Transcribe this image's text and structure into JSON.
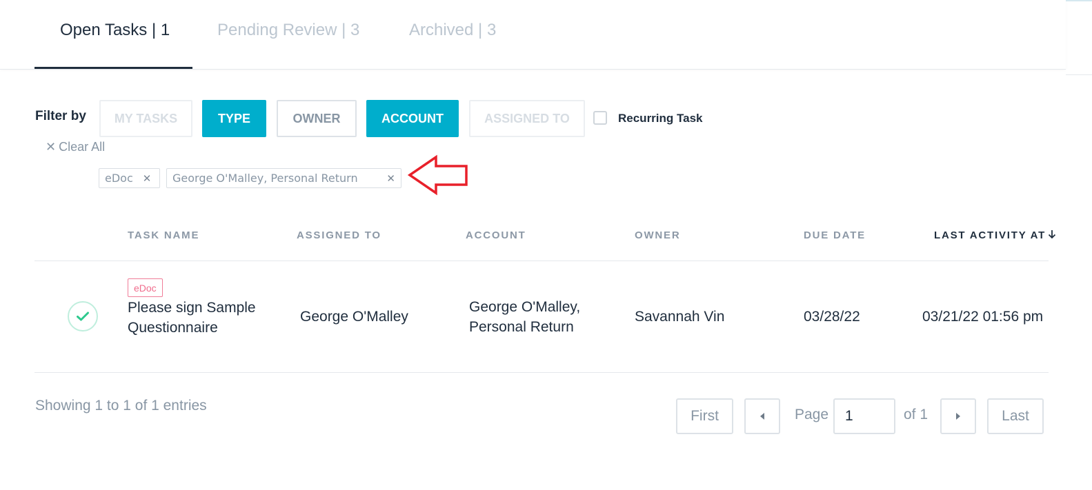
{
  "tabs": [
    {
      "label": "Open Tasks | 1",
      "active": true
    },
    {
      "label": "Pending Review | 3",
      "active": false
    },
    {
      "label": "Archived | 3",
      "active": false
    }
  ],
  "filter": {
    "label": "Filter by",
    "buttons": {
      "my_tasks": "MY TASKS",
      "type": "TYPE",
      "owner": "OWNER",
      "account": "ACCOUNT",
      "assigned_to": "ASSIGNED TO"
    },
    "recurring_label": "Recurring Task",
    "clear_all": "Clear All",
    "chips": [
      "eDoc",
      "George O'Malley, Personal Return"
    ]
  },
  "table": {
    "headers": {
      "task_name": "TASK NAME",
      "assigned_to": "ASSIGNED TO",
      "account": "ACCOUNT",
      "owner": "OWNER",
      "due_date": "DUE DATE",
      "last_activity": "LAST ACTIVITY AT"
    },
    "rows": [
      {
        "tag": "eDoc",
        "task_name": "Please sign Sample Questionnaire",
        "assigned_to": "George O'Malley",
        "account": "George O'Malley, Personal Return",
        "owner": "Savannah Vin",
        "due_date": "03/28/22",
        "last_activity": "03/21/22 01:56 pm"
      }
    ]
  },
  "pagination": {
    "showing": "Showing 1 to 1 of 1 entries",
    "first": "First",
    "page_label": "Page",
    "page_value": "1",
    "of_label": "of 1",
    "last": "Last"
  },
  "colors": {
    "accent": "#00aecc",
    "active_tab_underline": "#1f2d3d",
    "tag_pink": "#f06c8c",
    "check_green": "#2ec98e",
    "annotation_arrow": "#e8202a"
  },
  "icons": [
    "check-icon",
    "close-icon",
    "arrow-down-icon",
    "caret-left-icon",
    "caret-right-icon",
    "annotation-arrow-icon"
  ]
}
